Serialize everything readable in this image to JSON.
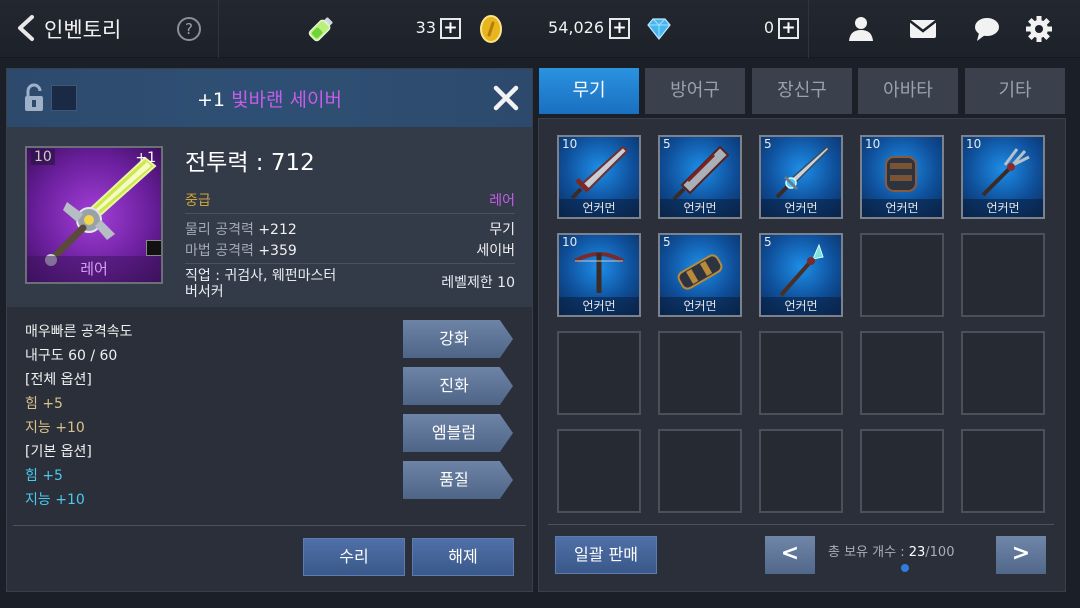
{
  "topbar": {
    "title": "인벤토리",
    "help": "?",
    "stamina": "33",
    "gold": "54,026",
    "gems": "0",
    "plus": "+"
  },
  "item": {
    "enhance": "+1",
    "name": "빛바랜 세이버",
    "thumb_level": "10",
    "thumb_plus": "+1",
    "thumb_rarity": "레어",
    "power": "전투력 : 712",
    "grade": "중급",
    "rarity": "레어",
    "phys_label": "물리 공격력",
    "phys_value": "+212",
    "magic_label": "마법 공격력",
    "magic_value": "+359",
    "type1": "무기",
    "type2": "세이버",
    "job": "직업 : 귀검사, 웨펀마스터",
    "job2": "버서커",
    "level_limit": "레벨제한 10"
  },
  "desc": {
    "line1": "매우빠른 공격속도",
    "line2": "내구도 60 / 60",
    "line3": "[전체 옵션]",
    "line4": "힘 +5",
    "line5": "지능 +10",
    "line6": "[기본 옵션]",
    "line7": "힘 +5",
    "line8": "지능 +10"
  },
  "actions": {
    "enhance": "강화",
    "evolve": "진화",
    "emblem": "엠블럼",
    "quality": "품질",
    "repair": "수리",
    "unequip": "해제"
  },
  "tabs": [
    "무기",
    "방어구",
    "장신구",
    "아바타",
    "기타"
  ],
  "slots": [
    {
      "lv": "10",
      "rarity": "언커먼",
      "icon": "greatsword-icon"
    },
    {
      "lv": "5",
      "rarity": "언커먼",
      "icon": "broadsword-icon"
    },
    {
      "lv": "5",
      "rarity": "언커먼",
      "icon": "saber-icon"
    },
    {
      "lv": "10",
      "rarity": "언커먼",
      "icon": "gauntlet-icon"
    },
    {
      "lv": "10",
      "rarity": "언커먼",
      "icon": "trident-icon"
    },
    {
      "lv": "10",
      "rarity": "언커먼",
      "icon": "crossbow-icon"
    },
    {
      "lv": "5",
      "rarity": "언커먼",
      "icon": "cannon-icon"
    },
    {
      "lv": "5",
      "rarity": "언커먼",
      "icon": "staff-icon"
    }
  ],
  "footer": {
    "sell_all": "일괄 판매",
    "prev": "<",
    "next": ">",
    "count_label": "총 보유 개수 : ",
    "count_have": "23",
    "count_max": "/100"
  },
  "colors": {
    "accent": "#1a6fc0",
    "rare": "#c45de8",
    "grade": "#c9a43a",
    "option": "#4cc9f0"
  }
}
